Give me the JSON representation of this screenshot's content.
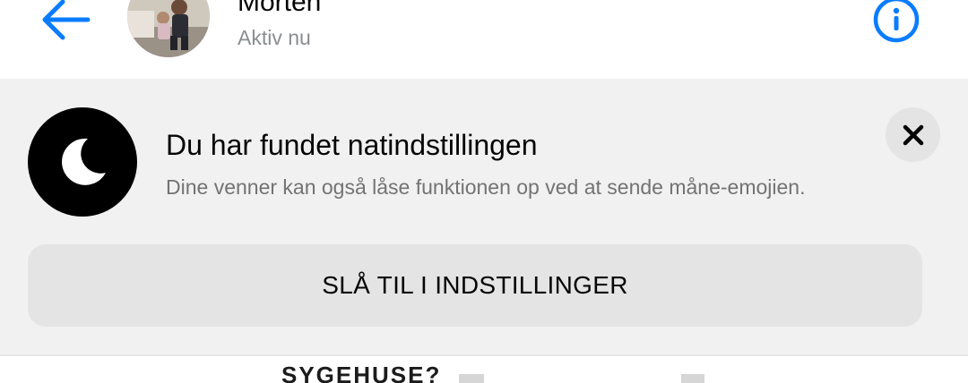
{
  "header": {
    "contact_name": "Morten",
    "status": "Aktiv nu",
    "back_icon": "arrow-left-icon",
    "info_icon": "info-icon",
    "accent_color": "#0a7cff"
  },
  "banner": {
    "icon": "moon-icon",
    "title": "Du har fundet natindstillingen",
    "description": "Dine venner kan også låse funktionen op ved at sende måne-emojien.",
    "close_icon": "close-icon",
    "button_label": "SLÅ TIL I INDSTILLINGER"
  },
  "chat": {
    "partial_sticker_text": "SYGEHUSE?"
  }
}
